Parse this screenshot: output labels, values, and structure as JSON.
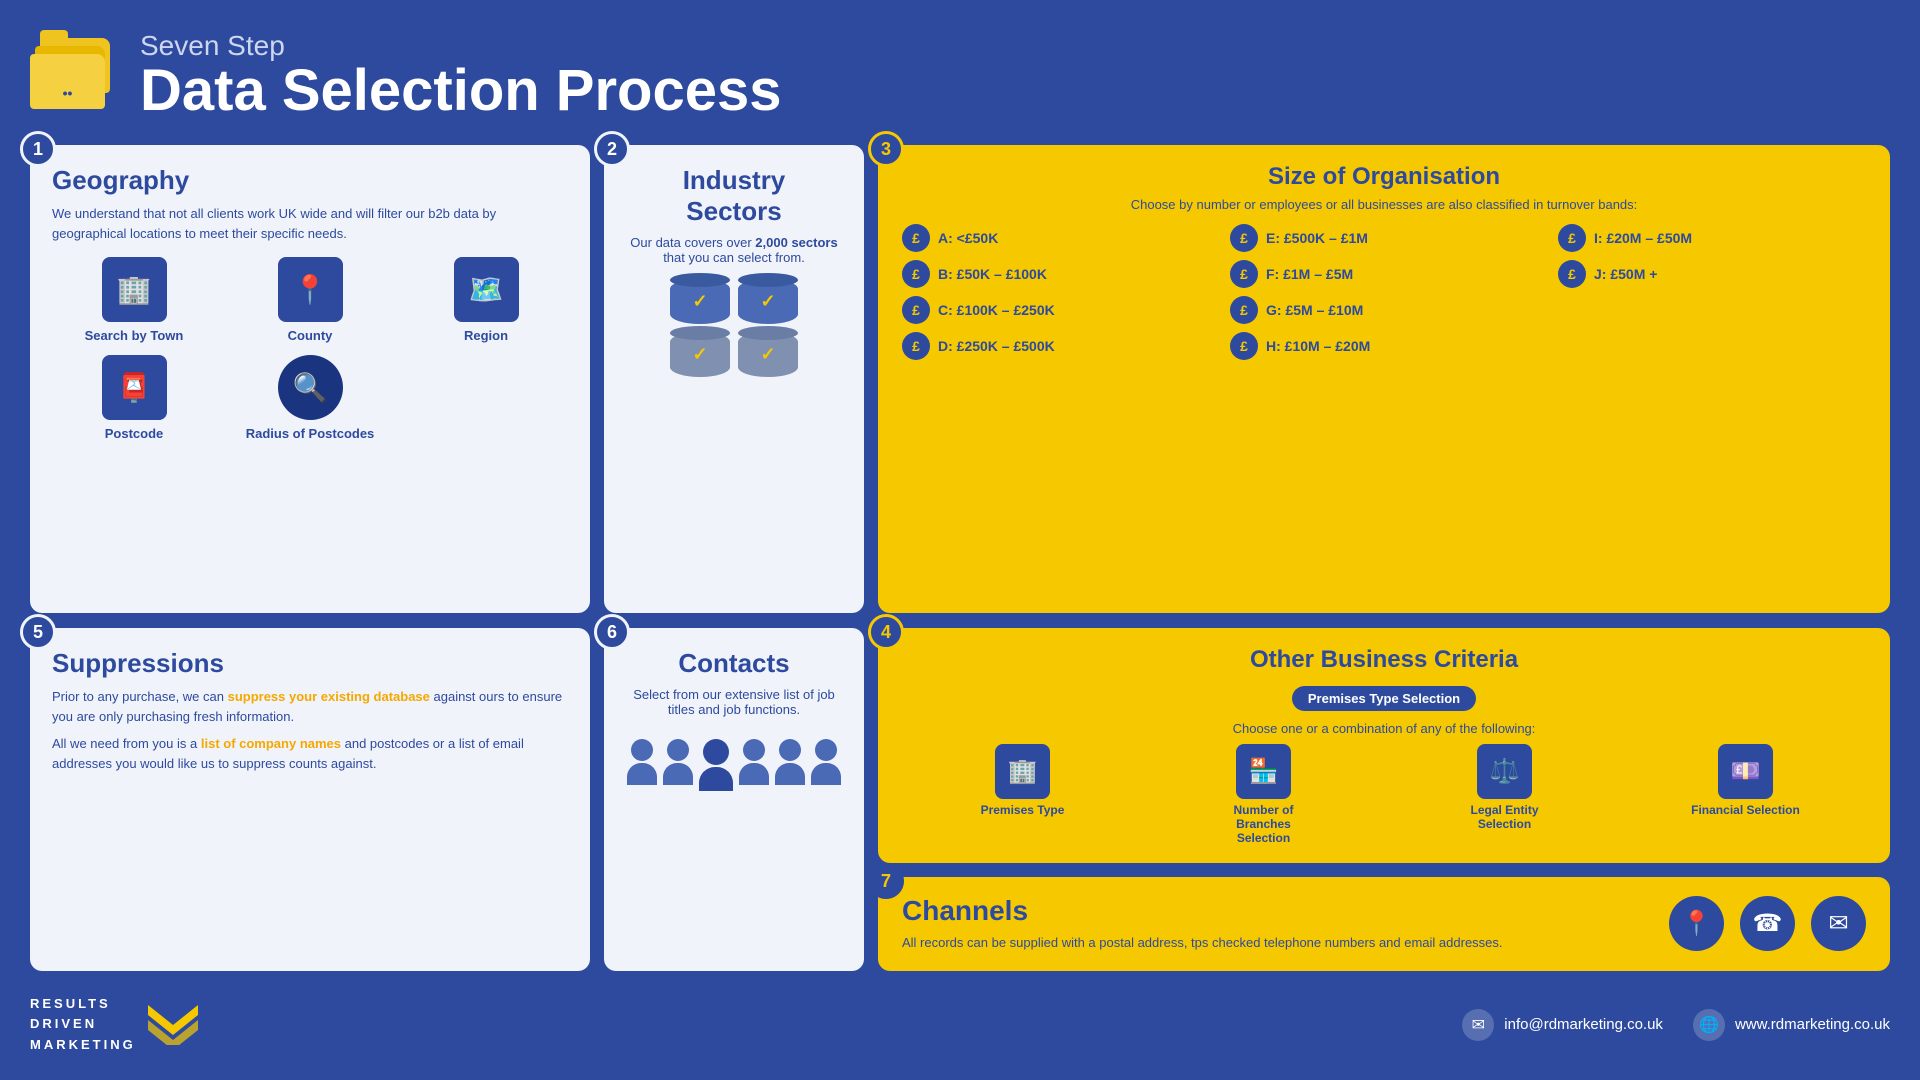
{
  "header": {
    "subtitle": "Seven Step",
    "title": "Data Selection Process",
    "folder_alt": "folder icon"
  },
  "steps": {
    "geography": {
      "step": "1",
      "title": "Geography",
      "body": "We understand that not all clients work UK wide and will filter our b2b data by geographical locations to meet their specific needs.",
      "icons": [
        {
          "label": "Search by Town",
          "icon": "🏢"
        },
        {
          "label": "County",
          "icon": "📍"
        },
        {
          "label": "Region",
          "icon": "🗺️"
        },
        {
          "label": "Postcode",
          "icon": "📮"
        },
        {
          "label": "Radius of Postcodes",
          "icon": "🔍"
        }
      ]
    },
    "industry": {
      "step": "2",
      "title": "Industry Sectors",
      "body_pre": "Our data covers over ",
      "highlight": "2,000 sectors",
      "body_post": " that you can select from."
    },
    "size": {
      "step": "3",
      "title": "Size of Organisation",
      "subtitle": "Choose by number or employees or all businesses are also classified in turnover bands:",
      "bands": [
        {
          "label": "A: <£50K"
        },
        {
          "label": "E: £500K – £1M"
        },
        {
          "label": "I: £20M – £50M"
        },
        {
          "label": "B: £50K – £100K"
        },
        {
          "label": "F: £1M – £5M"
        },
        {
          "label": "J: £50M +"
        },
        {
          "label": "C: £100K – £250K"
        },
        {
          "label": "G: £5M – £10M"
        },
        {
          "label": ""
        },
        {
          "label": "D: £250K – £500K"
        },
        {
          "label": "H: £10M – £20M"
        },
        {
          "label": ""
        }
      ]
    },
    "other": {
      "step": "4",
      "title": "Other Business Criteria",
      "badge": "Premises Type Selection",
      "subtitle": "Choose one or a combination of any of the following:",
      "criteria": [
        {
          "label": "Premises Type",
          "icon": "🏢"
        },
        {
          "label": "Number of Branches Selection",
          "icon": "🏪"
        },
        {
          "label": "Legal Entity Selection",
          "icon": "⚖️"
        },
        {
          "label": "Financial Selection",
          "icon": "💷"
        }
      ]
    },
    "suppressions": {
      "step": "5",
      "title": "Suppressions",
      "body1": "Prior to any purchase, we can ",
      "highlight1": "suppress your existing database",
      "body1b": " against ours to ensure you are only purchasing fresh information.",
      "body2_pre": "All we need from you is a ",
      "highlight2": "list of company names",
      "body2_post": " and postcodes or a list of email addresses you would like us to suppress counts against."
    },
    "contacts": {
      "step": "6",
      "title": "Contacts",
      "body": "Select from our extensive list of job titles and job functions."
    },
    "channels": {
      "step": "7",
      "title": "Channels",
      "body": "All records can be supplied with a postal address, tps checked telephone numbers and email addresses.",
      "icons": [
        "📍",
        "📞",
        "✉️"
      ]
    }
  },
  "footer": {
    "logo_lines": [
      "RESULTS",
      "DRIVEN",
      "MARKETING"
    ],
    "email_icon": "✉",
    "email": "info@rdmarketing.co.uk",
    "globe_icon": "🌐",
    "website": "www.rdmarketing.co.uk"
  }
}
